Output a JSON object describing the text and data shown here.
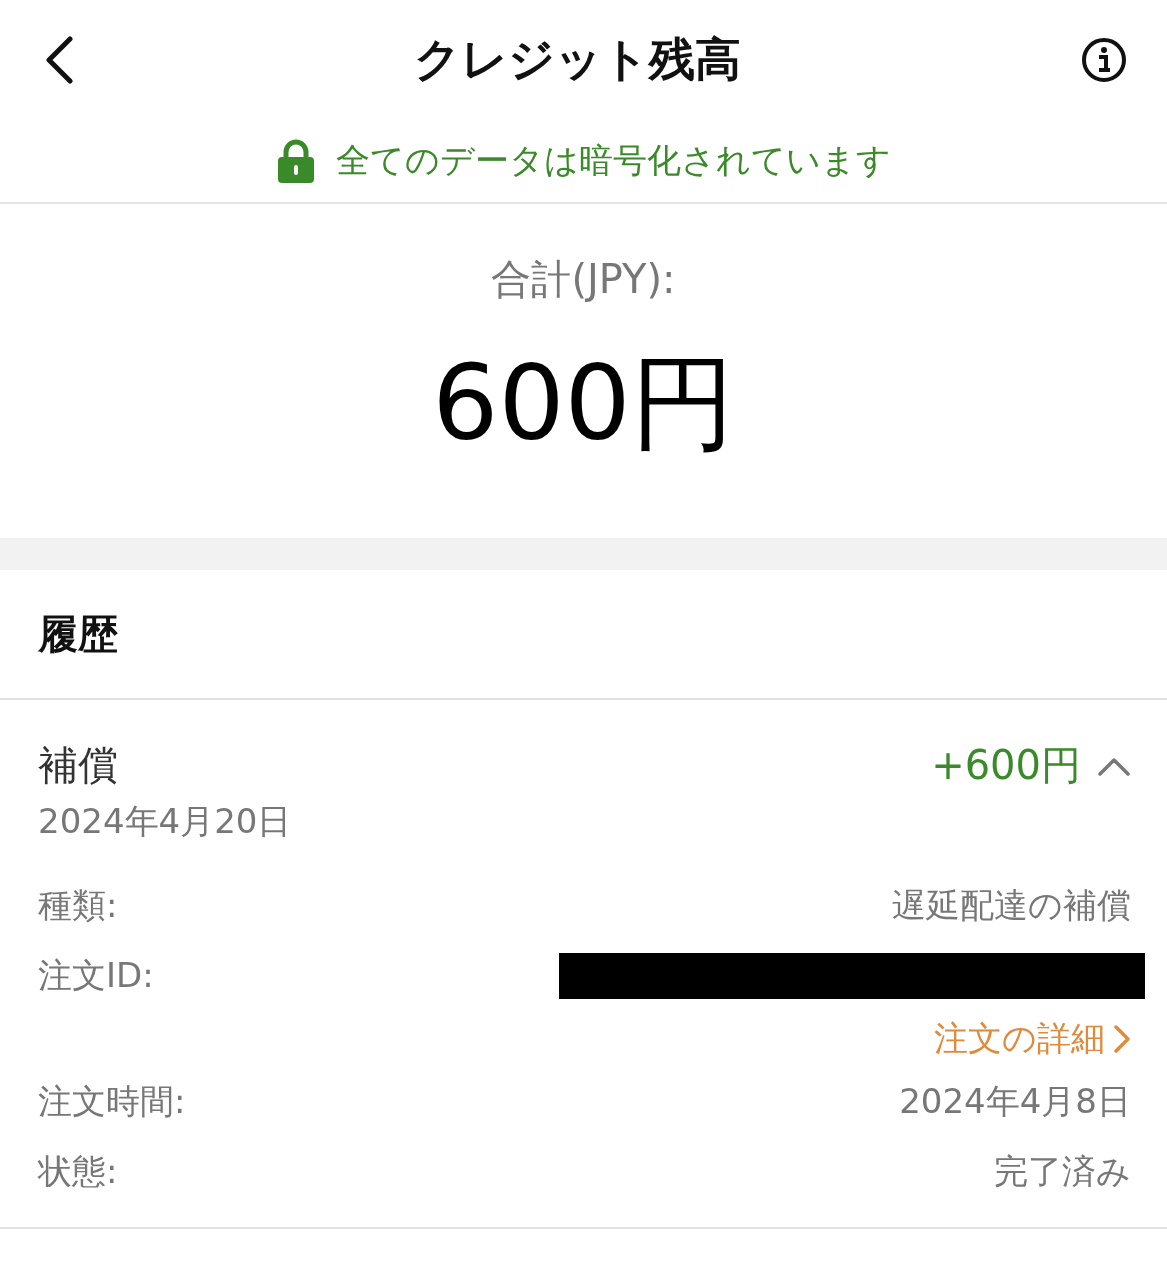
{
  "header": {
    "title": "クレジット残高"
  },
  "security_notice": "全てのデータは暗号化されています",
  "balance": {
    "label": "合計(JPY):",
    "amount": "600円"
  },
  "history": {
    "title": "履歴",
    "entries": [
      {
        "title": "補償",
        "date": "2024年4月20日",
        "amount": "+600円",
        "expanded": true,
        "details": [
          {
            "kind": "text",
            "label": "種類:",
            "value": "遅延配達の補償"
          },
          {
            "kind": "redacted",
            "label": "注文ID:",
            "link": "注文の詳細"
          },
          {
            "kind": "text",
            "label": "注文時間:",
            "value": "2024年4月8日"
          },
          {
            "kind": "text",
            "label": "状態:",
            "value": "完了済み"
          }
        ]
      }
    ]
  }
}
